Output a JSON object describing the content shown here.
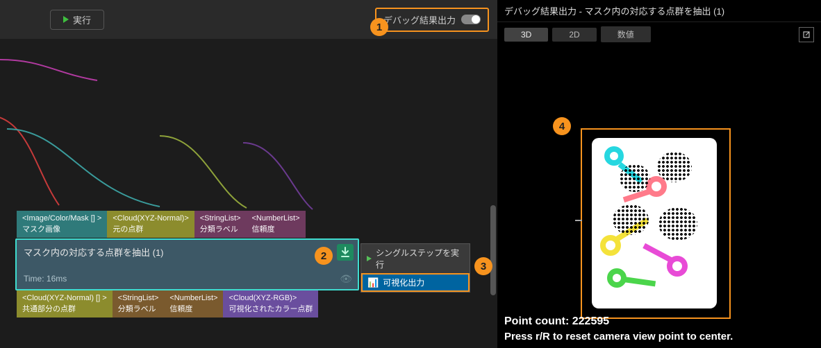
{
  "toolbar": {
    "run_label": "実行",
    "debug_label": "デバッグ結果出力"
  },
  "inputs": [
    {
      "type": "<Image/Color/Mask [] >",
      "label": "マスク画像",
      "cls": "pTeal"
    },
    {
      "type": "<Cloud(XYZ-Normal)>",
      "label": "元の点群",
      "cls": "pOlive"
    },
    {
      "type": "<StringList>",
      "label": "分類ラベル",
      "cls": "pPlum"
    },
    {
      "type": "<NumberList>",
      "label": "信頼度",
      "cls": "pPlum"
    }
  ],
  "node": {
    "title": "マスク内の対応する点群を抽出 (1)",
    "time": "Time: 16ms"
  },
  "outputs": [
    {
      "type": "<Cloud(XYZ-Normal) [] >",
      "label": "共通部分の点群",
      "cls": "pOlive"
    },
    {
      "type": "<StringList>",
      "label": "分類ラベル",
      "cls": "pBrown"
    },
    {
      "type": "<NumberList>",
      "label": "信頼度",
      "cls": "pBrown"
    },
    {
      "type": "<Cloud(XYZ-RGB)>",
      "label": "可視化されたカラー点群",
      "cls": "pPurple"
    }
  ],
  "ctx_menu": {
    "item_step": "シングルステップを実行",
    "item_vis": "可視化出力"
  },
  "right": {
    "title": "デバッグ結果出力 - マスク内の対応する点群を抽出 (1)",
    "tab_3d": "3D",
    "tab_2d": "2D",
    "tab_num": "数値",
    "point_count_label": "Point count: 222595",
    "reset_hint": "Press r/R to reset camera view point to center."
  },
  "callouts": {
    "c1": "1",
    "c2": "2",
    "c3": "3",
    "c4": "4"
  }
}
